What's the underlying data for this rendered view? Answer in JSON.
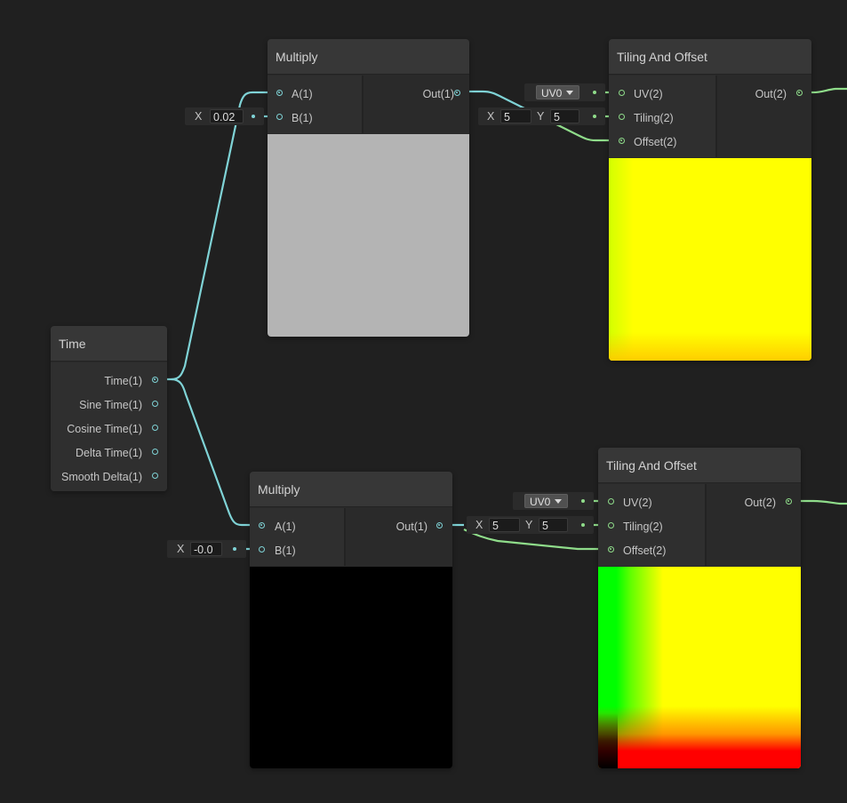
{
  "time_node": {
    "title": "Time",
    "outputs": [
      "Time(1)",
      "Sine Time(1)",
      "Cosine Time(1)",
      "Delta Time(1)",
      "Smooth Delta(1)"
    ]
  },
  "multiply_top": {
    "title": "Multiply",
    "input_a": "A(1)",
    "input_b": "B(1)",
    "output": "Out(1)",
    "b_axis": "X",
    "b_value": "0.02"
  },
  "multiply_bottom": {
    "title": "Multiply",
    "input_a": "A(1)",
    "input_b": "B(1)",
    "output": "Out(1)",
    "b_axis": "X",
    "b_value": "-0.0"
  },
  "tiling_top": {
    "title": "Tiling And Offset",
    "uv": "UV(2)",
    "tiling": "Tiling(2)",
    "offset": "Offset(2)",
    "output": "Out(2)",
    "uv_channel": "UV0",
    "tiling_x_label": "X",
    "tiling_x": "5",
    "tiling_y_label": "Y",
    "tiling_y": "5"
  },
  "tiling_bottom": {
    "title": "Tiling And Offset",
    "uv": "UV(2)",
    "tiling": "Tiling(2)",
    "offset": "Offset(2)",
    "output": "Out(2)",
    "uv_channel": "UV0",
    "tiling_x_label": "X",
    "tiling_x": "5",
    "tiling_y_label": "Y",
    "tiling_y": "5"
  },
  "colors": {
    "canvas": "#202020",
    "float_wire": "#7fd3d6",
    "vector2_wire": "#8fdc8a",
    "preview_grey": "#b4b4b4",
    "preview_black": "#000000",
    "preview_yellow": "#ffff00"
  }
}
